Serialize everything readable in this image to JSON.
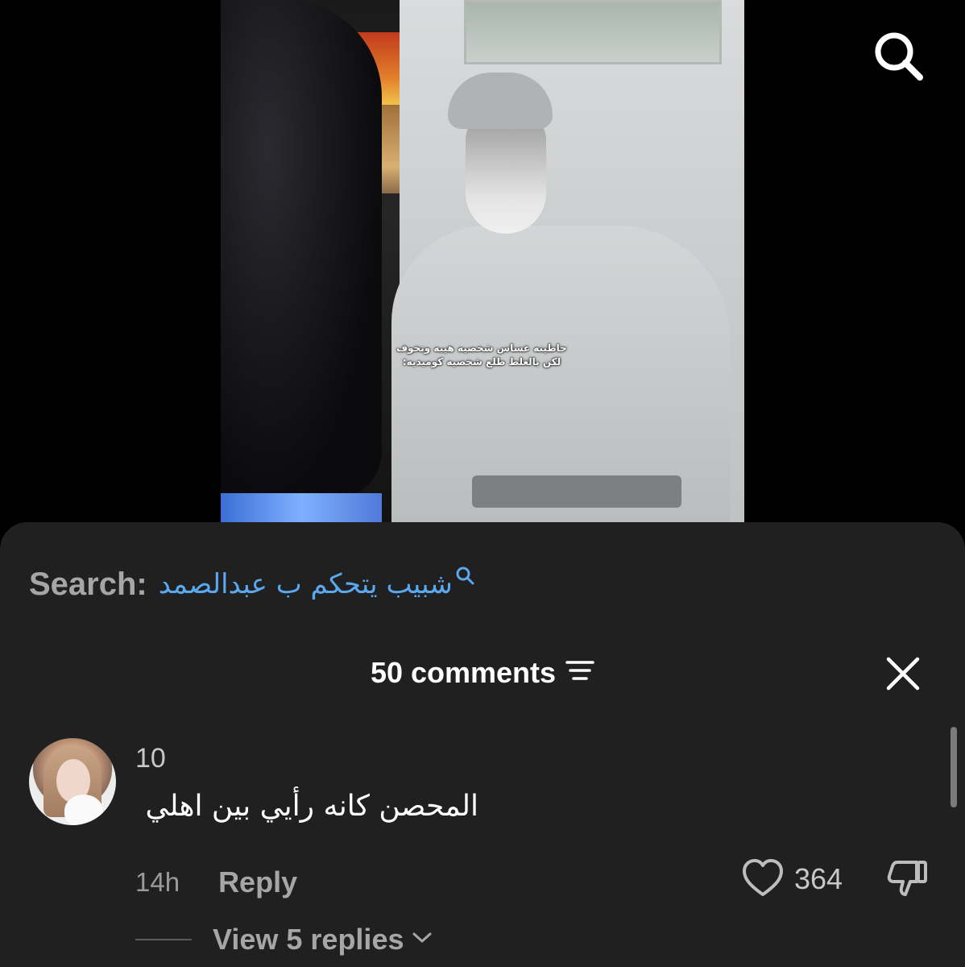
{
  "video": {
    "caption_line1": "حاطينه عساس شخصيه هيبه وتخوف",
    "caption_line2": "لكن بالغلط طلع شخصيه كوميديه:"
  },
  "icons": {
    "top_search": "search-icon",
    "search_suggestion": "search-icon",
    "sort": "sort-lines-icon",
    "close": "close-icon",
    "like": "heart-icon",
    "dislike": "thumbs-down-icon",
    "replies_expand": "chevron-down-icon"
  },
  "sheet": {
    "search_label": "Search:",
    "search_term": "شبيب يتحكم ب عبدالصمد",
    "comments_count": "50 comments"
  },
  "comment": {
    "username": "10",
    "text": "المحصن كانه رأيي بين اهلي",
    "time": "14h",
    "reply_label": "Reply",
    "likes": "364",
    "view_replies": "View 5 replies"
  },
  "colors": {
    "sheet_bg": "#202020",
    "link_blue": "#5aa8f0",
    "muted_text": "#a6a6a6"
  }
}
